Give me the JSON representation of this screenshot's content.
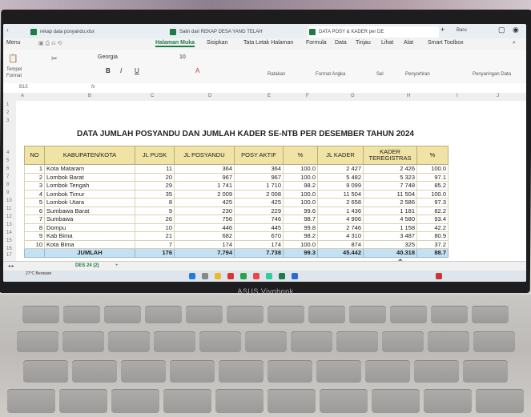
{
  "browser": {
    "tabs": [
      {
        "label": "rekap data posyandu.xlsx"
      },
      {
        "label": "Salin dari REKAP DESA YANG TELAH"
      },
      {
        "label": "DATA POSY & KADER per DE"
      }
    ],
    "new_tab": "+",
    "new_tab_label": "Baru"
  },
  "menu": {
    "app_menu": "Menu",
    "items": [
      "Halaman Muka",
      "Sisipkan",
      "Tata Letak Halaman",
      "Formula",
      "Data",
      "Tinjau",
      "Lihat",
      "Alat",
      "Smart Toolbox"
    ],
    "active": "Halaman Muka"
  },
  "ribbon": {
    "paste_label": "Tempel",
    "format_label": "Format",
    "font_name": "Georgia",
    "font_size": "10",
    "bold": "B",
    "italic": "I",
    "underline": "U",
    "wrap_label": "Ratakan",
    "number_format_label": "Format Angka",
    "cells_label": "Sel",
    "sort_label": "Penyortiran",
    "filter_label": "Penyaringan Data"
  },
  "formula_bar": {
    "cell_ref": "B15",
    "fx": "fx",
    "value": ""
  },
  "columns": [
    "A",
    "B",
    "C",
    "D",
    "E",
    "F",
    "G",
    "H",
    "I",
    "J"
  ],
  "rows": [
    "1",
    "2",
    "3",
    "4",
    "5",
    "6",
    "7",
    "8",
    "9",
    "10",
    "11",
    "12",
    "13",
    "14",
    "15",
    "16",
    "17",
    "18"
  ],
  "sheet": {
    "title": "DATA JUMLAH POSYANDU DAN JUMLAH KADER SE-NTB PER DESEMBER TAHUN 2024",
    "headers": [
      "NO",
      "KABUPATEN/KOTA",
      "JL PUSK",
      "JL POSYANDU",
      "POSY AKTIF",
      "%",
      "JL KADER",
      "KADER TEREGISTRAS",
      "%"
    ],
    "data_rows": [
      [
        "1",
        "Kota Mataram",
        "11",
        "364",
        "364",
        "100.0",
        "2 427",
        "2 426",
        "100.0"
      ],
      [
        "2",
        "Lombok Barat",
        "20",
        "967",
        "967",
        "100.0",
        "5 482",
        "5 323",
        "97.1"
      ],
      [
        "3",
        "Lombok Tengah",
        "29",
        "1 741",
        "1 710",
        "98.2",
        "9 099",
        "7 748",
        "85.2"
      ],
      [
        "4",
        "Lombok Timur",
        "35",
        "2 009",
        "2 008",
        "100.0",
        "11 504",
        "11 504",
        "100.0"
      ],
      [
        "5",
        "Lombok Utara",
        "8",
        "425",
        "425",
        "100.0",
        "2 658",
        "2 586",
        "97.3"
      ],
      [
        "6",
        "Sumbawa Barat",
        "9",
        "230",
        "229",
        "99.6",
        "1 436",
        "1 181",
        "82.2"
      ],
      [
        "7",
        "Sumbawa",
        "26",
        "756",
        "746",
        "98.7",
        "4 906",
        "4 580",
        "93.4"
      ],
      [
        "8",
        "Dompu",
        "10",
        "446",
        "445",
        "99.8",
        "2 746",
        "1 158",
        "42.2"
      ],
      [
        "9",
        "Kab Bima",
        "21",
        "682",
        "670",
        "98.2",
        "4 310",
        "3 487",
        "80.9"
      ],
      [
        "10",
        "Kota Bima",
        "7",
        "174",
        "174",
        "100.0",
        "874",
        "325",
        "37.2"
      ]
    ],
    "total_row": [
      "",
      "JUMLAH",
      "176",
      "7.794",
      "7.738",
      "99.3",
      "45.442",
      "40.318",
      "88.7"
    ]
  },
  "sheet_tabs": {
    "active": "DES 24 (2)",
    "add": "+"
  },
  "taskbar": {
    "weather": "27°C Berawan"
  },
  "brand": "ASUS Vivobook"
}
